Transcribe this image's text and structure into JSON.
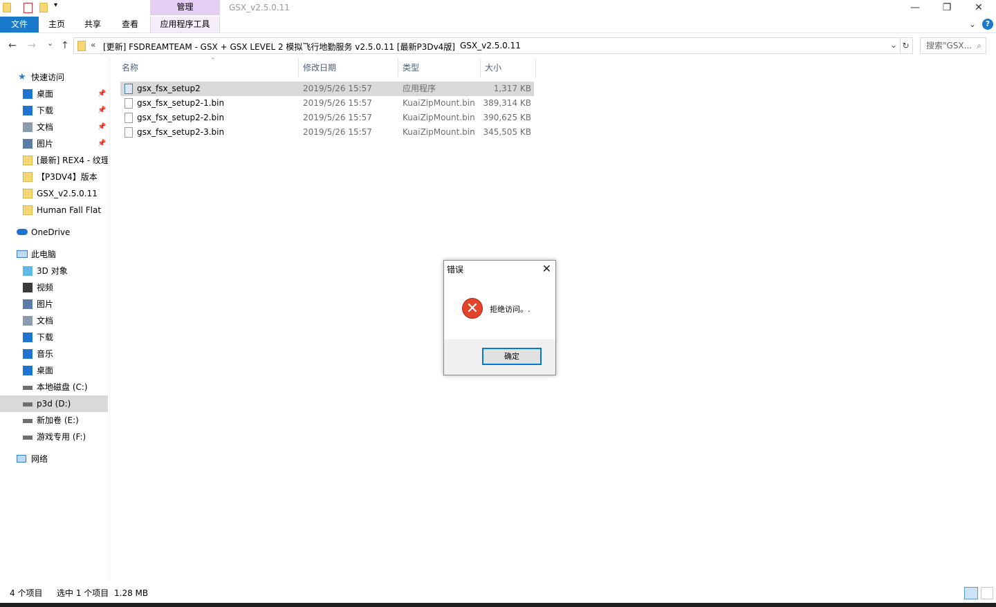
{
  "titlebar": {
    "manage_tab": "管理",
    "window_title": "GSX_v2.5.0.11",
    "minimize": "—",
    "restore": "❐",
    "close": "✕"
  },
  "ribbon": {
    "tabs": [
      "文件",
      "主页",
      "共享",
      "查看",
      "应用程序工具"
    ],
    "collapse": "⌄",
    "help": "?"
  },
  "address": {
    "back": "←",
    "forward": "→",
    "recent": "⌄",
    "up": "↑",
    "chevrons": "«",
    "crumb1": "[更新] FSDREAMTEAM - GSX + GSX LEVEL 2 模拟飞行地勤服务 v2.5.0.11 [最新P3Dv4版]",
    "separator": "›",
    "crumb2": "GSX_v2.5.0.11",
    "dropdown": "⌄",
    "refresh": "↻",
    "search_placeholder": "搜索\"GSX..."
  },
  "nav": {
    "quick_access": "快速访问",
    "quick_items": [
      {
        "label": "桌面",
        "pinned": true
      },
      {
        "label": "下载",
        "pinned": true
      },
      {
        "label": "文档",
        "pinned": true
      },
      {
        "label": "图片",
        "pinned": true
      },
      {
        "label": "[最新] REX4 - 纹理",
        "pinned": false
      },
      {
        "label": "【P3DV4】版本",
        "pinned": false
      },
      {
        "label": "GSX_v2.5.0.11",
        "pinned": false
      },
      {
        "label": "Human  Fall Flat",
        "pinned": false
      }
    ],
    "onedrive": "OneDrive",
    "this_pc": "此电脑",
    "pc_items": [
      "3D 对象",
      "视频",
      "图片",
      "文档",
      "下载",
      "音乐",
      "桌面",
      "本地磁盘 (C:)",
      "p3d (D:)",
      "新加卷 (E:)",
      "游戏专用 (F:)"
    ],
    "network": "网络"
  },
  "columns": {
    "name": "名称",
    "date": "修改日期",
    "type": "类型",
    "size": "大小"
  },
  "files": [
    {
      "name": "gsx_fsx_setup2",
      "date": "2019/5/26 15:57",
      "type": "应用程序",
      "size": "1,317 KB"
    },
    {
      "name": "gsx_fsx_setup2-1.bin",
      "date": "2019/5/26 15:57",
      "type": "KuaiZipMount.bin",
      "size": "389,314 KB"
    },
    {
      "name": "gsx_fsx_setup2-2.bin",
      "date": "2019/5/26 15:57",
      "type": "KuaiZipMount.bin",
      "size": "390,625 KB"
    },
    {
      "name": "gsx_fsx_setup2-3.bin",
      "date": "2019/5/26 15:57",
      "type": "KuaiZipMount.bin",
      "size": "345,505 KB"
    }
  ],
  "status": {
    "count": "4 个项目",
    "selected": "选中 1 个项目",
    "selected_size": "1.28 MB"
  },
  "dialog": {
    "title": "错误",
    "close": "✕",
    "icon": "✕",
    "message": "拒绝访问。.",
    "ok": "确定"
  },
  "colors": {
    "file_tab": "#1979ca",
    "manage_tab": "#e6cff5",
    "error_red": "#e2432a",
    "selection": "#d9d9d9"
  }
}
